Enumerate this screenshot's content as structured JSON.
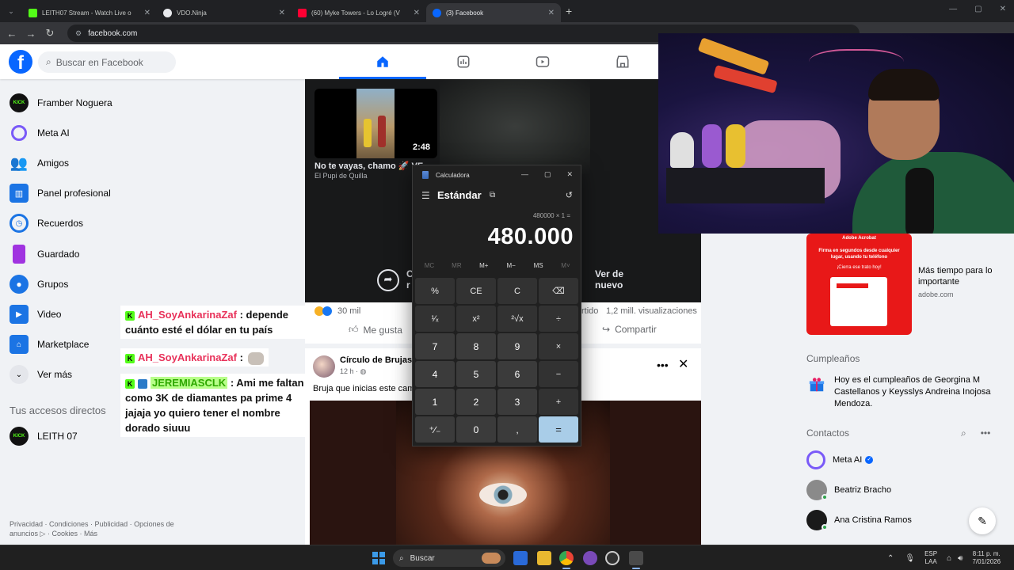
{
  "browser": {
    "tabs": [
      {
        "label": "LEITH07 Stream - Watch Live o",
        "fav_color": "#53fc18"
      },
      {
        "label": "VDO.Ninja",
        "fav_color": "#ffffff"
      },
      {
        "label": "(60) Myke Towers - Lo Logré (V",
        "fav_color": "#ff0033"
      },
      {
        "label": "(3) Facebook",
        "fav_color": "#0866ff"
      }
    ],
    "url": "facebook.com"
  },
  "header": {
    "logo": "f",
    "search_placeholder": "Buscar en Facebook",
    "nav": [
      "home-icon",
      "dashboard-icon",
      "video-icon",
      "marketplace-icon"
    ]
  },
  "sidebar": {
    "items": [
      {
        "label": "Framber Noguera",
        "icon": "kick-avatar"
      },
      {
        "label": "Meta AI",
        "icon": "meta-ai-icon"
      },
      {
        "label": "Amigos",
        "icon": "friends-icon"
      },
      {
        "label": "Panel profesional",
        "icon": "dashboard-icon"
      },
      {
        "label": "Recuerdos",
        "icon": "memories-icon"
      },
      {
        "label": "Guardado",
        "icon": "saved-icon"
      },
      {
        "label": "Grupos",
        "icon": "groups-icon"
      },
      {
        "label": "Video",
        "icon": "video-icon"
      },
      {
        "label": "Marketplace",
        "icon": "marketplace-icon"
      },
      {
        "label": "Ver más",
        "icon": "chevron-down-icon"
      }
    ],
    "shortcuts_heading": "Tus accesos directos",
    "shortcut": "LEITH 07",
    "footer": "Privacidad · Condiciones · Publicidad · Opciones de anuncios ▷ · Cookies · Más"
  },
  "feed": {
    "reel": {
      "duration": "2:48",
      "title": "No te vayas, chamo 🚀 VE",
      "author": "El Pupi de Quilla",
      "share_label": "C\nr",
      "replay_label": "Ver de\nnuevo"
    },
    "stats": {
      "reactions": "30 mil",
      "shares_partial": "rtido",
      "views": "1,2 mill. visualizaciones",
      "like": "Me gusta",
      "share": "Compartir"
    },
    "post": {
      "author": "Círculo de Brujas E",
      "time": "12 h · ",
      "text": "Bruja que inicias este cami"
    }
  },
  "right": {
    "ad": {
      "brand": "Adobe Acrobat",
      "copy": "Firma en segundos desde cualquier lugar, usando tu teléfono",
      "cta": "¡Cierra ese trato hoy!",
      "title": "Más tiempo para lo importante",
      "url": "adobe.com"
    },
    "birthdays_heading": "Cumpleaños",
    "birthday_text": "Hoy es el cumpleaños de Georgina M Castellanos y Keysslys Andreina Inojosa Mendoza.",
    "contacts_heading": "Contactos",
    "contacts": [
      {
        "name": "Meta AI",
        "verified": true
      },
      {
        "name": "Beatriz Bracho",
        "online": true
      },
      {
        "name": "Ana Cristina Ramos",
        "online": true
      }
    ]
  },
  "calculator": {
    "title": "Calculadora",
    "mode": "Estándar",
    "expression": "480000 × 1 =",
    "display": "480.000",
    "memory": [
      "MC",
      "MR",
      "M+",
      "M−",
      "MS",
      "M˅"
    ],
    "keys": [
      "%",
      "CE",
      "C",
      "⌫",
      "¹⁄ₓ",
      "x²",
      "²√x",
      "÷",
      "7",
      "8",
      "9",
      "×",
      "4",
      "5",
      "6",
      "−",
      "1",
      "2",
      "3",
      "+",
      "⁺∕₋",
      "0",
      ",",
      "="
    ]
  },
  "chat": {
    "messages": [
      {
        "user": "AH_SoyAnkarinaZaf",
        "text": ": depende cuánto esté el dólar en tu país"
      },
      {
        "user": "AH_SoyAnkarinaZaf",
        "text": ":"
      },
      {
        "user": "JEREMIASCLK",
        "text": ": Ami me faltan como 3K de diamantes pa prime 4 jajaja yo quiero tener el nombre dorado siuuu"
      }
    ]
  },
  "taskbar": {
    "search": "Buscar",
    "lang_1": "ESP",
    "lang_2": "LAA",
    "time": "8:11 p. m.",
    "date": "7/01/2026"
  }
}
